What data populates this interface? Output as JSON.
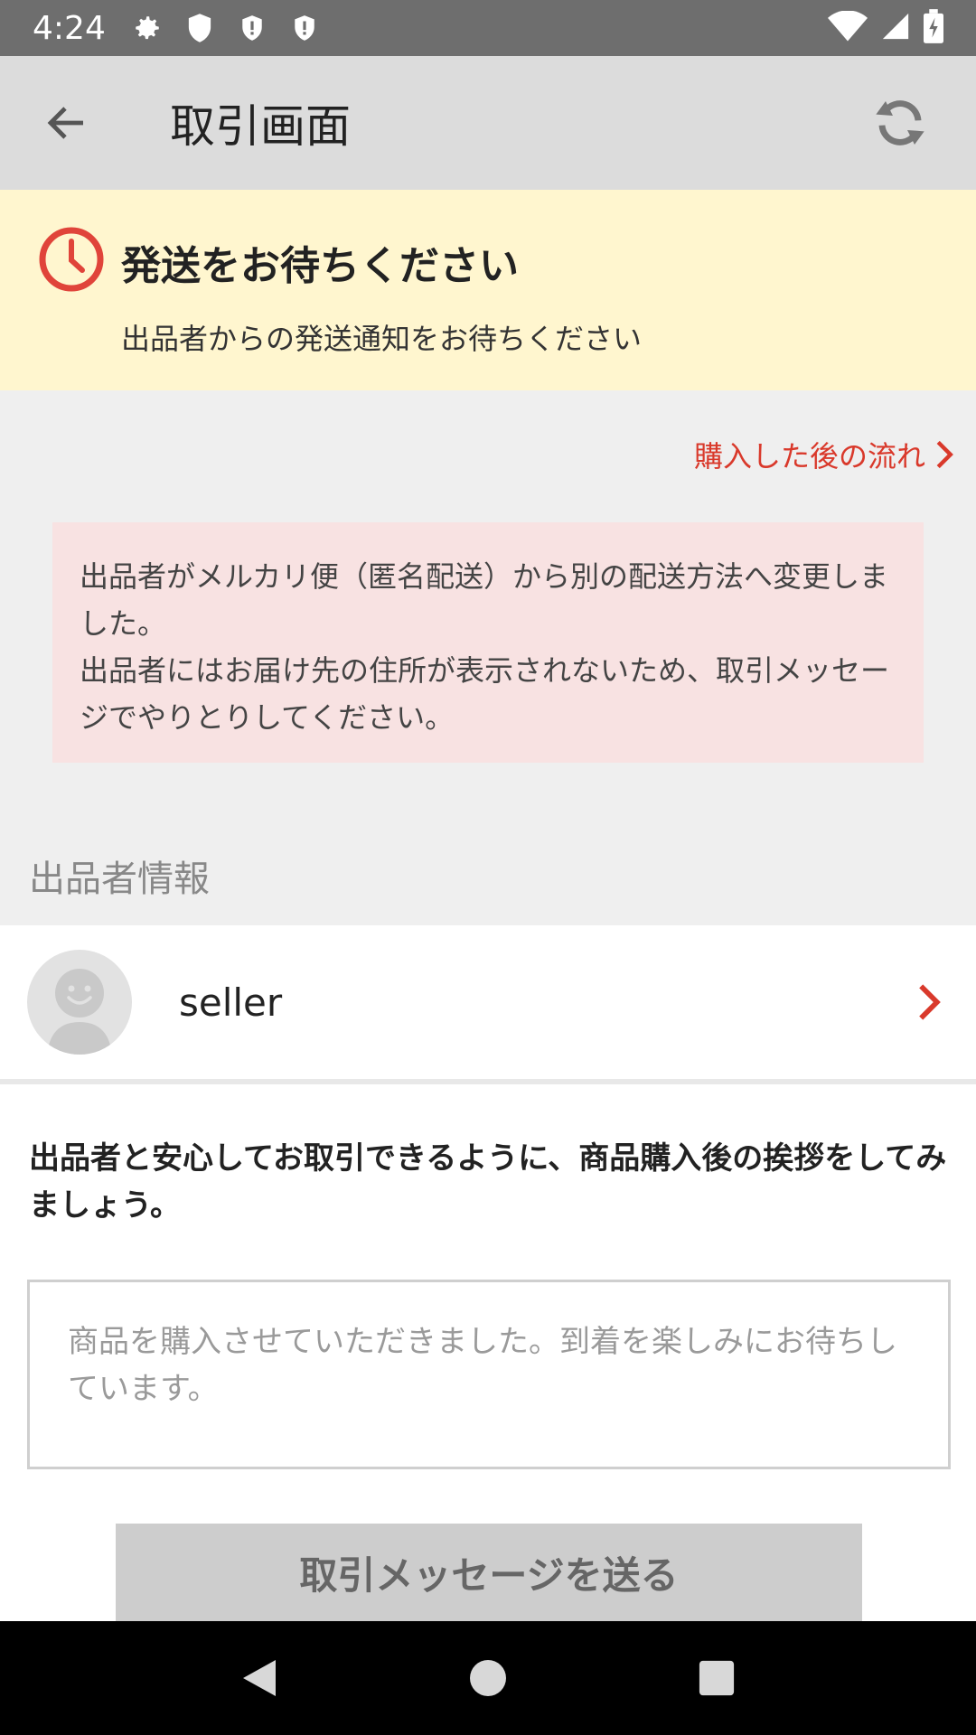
{
  "status_bar": {
    "time": "4:24",
    "icons_left": [
      "gear-icon",
      "shield-icon",
      "shield-alert-icon",
      "shield-alert-icon"
    ],
    "icons_right": [
      "wifi-icon",
      "signal-icon",
      "battery-icon"
    ]
  },
  "app_bar": {
    "title": "取引画面"
  },
  "notice": {
    "title": "発送をお待ちください",
    "subtitle": "出品者からの発送通知をお待ちください",
    "accent_color": "#e0443a",
    "background": "#fff6cf"
  },
  "flow_link": {
    "label": "購入した後の流れ",
    "color": "#d9392b"
  },
  "alert": {
    "line1": "出品者がメルカリ便（匿名配送）から別の配送方法へ変更しました。",
    "line2": "出品者にはお届け先の住所が表示されないため、取引メッセージでやりとりしてください。"
  },
  "seller_section": {
    "label": "出品者情報",
    "seller_name": "seller"
  },
  "compose": {
    "prompt": "出品者と安心してお取引できるように、商品購入後の挨拶をしてみましょう。",
    "placeholder": "商品を購入させていただきました。到着を楽しみにお待ちしています。",
    "send_label": "取引メッセージを送る"
  },
  "nav_bar": {
    "icons": [
      "back-triangle-icon",
      "home-circle-icon",
      "recents-square-icon"
    ]
  }
}
